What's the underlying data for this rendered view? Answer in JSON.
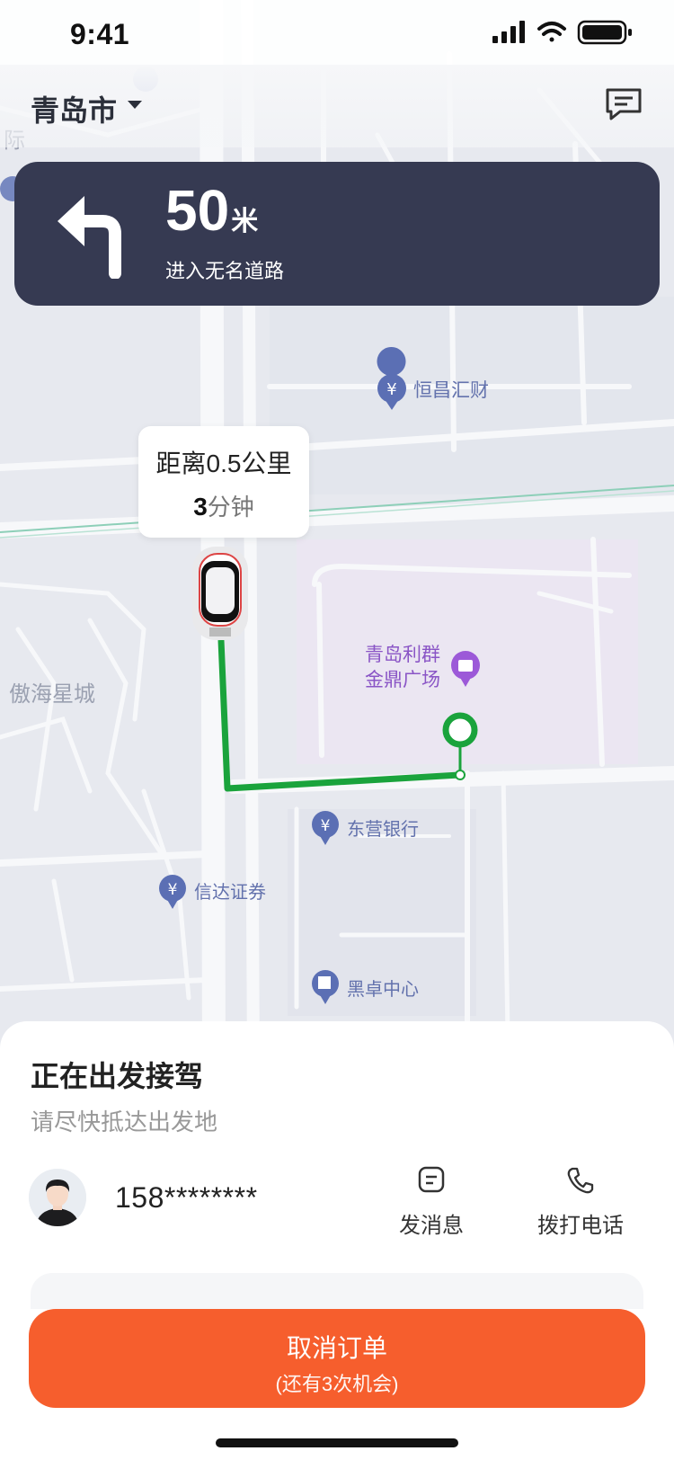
{
  "status_bar": {
    "time": "9:41"
  },
  "header": {
    "city": "青岛市"
  },
  "navigation": {
    "distance": "50",
    "unit": "米",
    "instruction": "进入无名道路"
  },
  "map": {
    "labels": [
      {
        "id": "hengchang",
        "text": "恒昌汇财",
        "icon": "bank-icon"
      },
      {
        "id": "liqun_line1",
        "text": "青岛利群"
      },
      {
        "id": "liqun_line2",
        "text": "金鼎广场",
        "icon": "shopping-icon"
      },
      {
        "id": "aohai",
        "text": "傲海星城"
      },
      {
        "id": "dongying",
        "text": "东营银行",
        "icon": "bank-icon"
      },
      {
        "id": "xinda",
        "text": "信达证券",
        "icon": "bank-icon"
      },
      {
        "id": "heizhuo",
        "text": "黑卓中心",
        "icon": "building-icon"
      },
      {
        "id": "ji",
        "text": "际"
      }
    ],
    "route_color": "#1aa33c"
  },
  "bubble": {
    "distance": "距离0.5公里",
    "minutes": "3",
    "minutes_unit": "分钟"
  },
  "sheet": {
    "title": "正在出发接驾",
    "subtitle": "请尽快抵达出发地",
    "phone": "158********",
    "message_label": "发消息",
    "call_label": "拨打电话"
  },
  "cancel": {
    "label": "取消订单",
    "sub": "(还有3次机会)",
    "color": "#f65e2d"
  }
}
